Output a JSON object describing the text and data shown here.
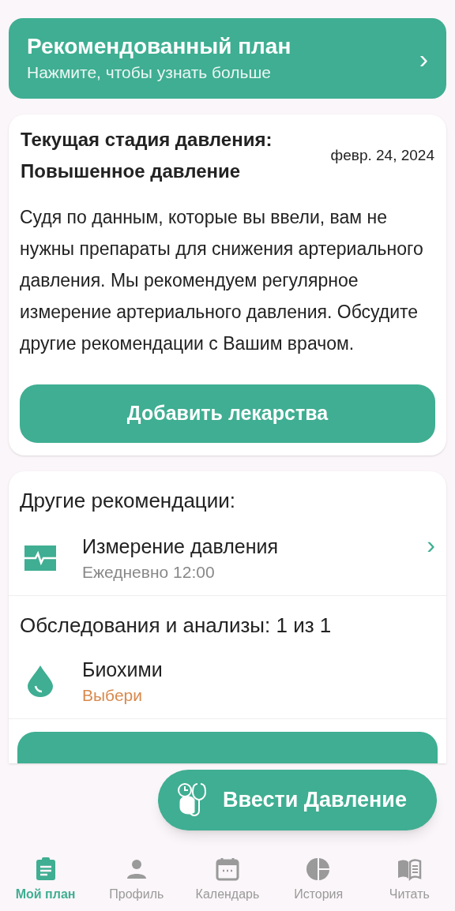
{
  "banner": {
    "title": "Рекомендованный план",
    "subtitle": "Нажмите, чтобы узнать больше",
    "chevron": "›"
  },
  "stage_card": {
    "title": "Текущая стадия давления: Повышенное давление",
    "date": "февр. 24, 2024",
    "text": "Судя по данным, которые вы ввели, вам не нужны препараты для снижения артериального давления. Мы рекомендуем регулярное измерение артериального давления. Обсудите другие рекомендации с Вашим врачом.",
    "button": "Добавить лекарства"
  },
  "other_card": {
    "title": "Другие рекомендации:",
    "items": [
      {
        "kind": "pulse",
        "title": "Измерение давления",
        "subtitle": "Ежедневно 12:00",
        "chevron": "›"
      }
    ],
    "tests_title": "Обследования и анализы: 1 из 1",
    "tests": [
      {
        "kind": "drop",
        "title": "Биохими",
        "subtitle": "Выбери"
      }
    ]
  },
  "fab": {
    "label": "Ввести Давление"
  },
  "nav": [
    {
      "kind": "plan",
      "label": "Мой план",
      "selected": true
    },
    {
      "kind": "profile",
      "label": "Профиль",
      "selected": false
    },
    {
      "kind": "calendar",
      "label": "Календарь",
      "selected": false
    },
    {
      "kind": "history",
      "label": "История",
      "selected": false
    },
    {
      "kind": "read",
      "label": "Читать",
      "selected": false
    }
  ]
}
